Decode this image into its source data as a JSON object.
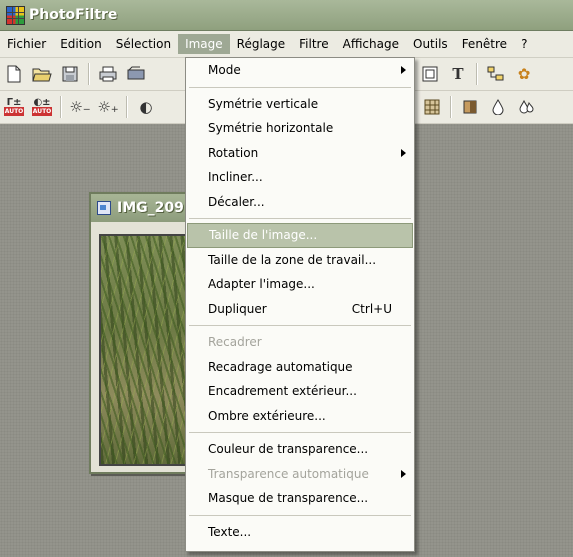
{
  "app": {
    "title": "PhotoFiltre"
  },
  "menubar": {
    "items": [
      {
        "label": "Fichier"
      },
      {
        "label": "Edition"
      },
      {
        "label": "Sélection"
      },
      {
        "label": "Image"
      },
      {
        "label": "Réglage"
      },
      {
        "label": "Filtre"
      },
      {
        "label": "Affichage"
      },
      {
        "label": "Outils"
      },
      {
        "label": "Fenêtre"
      },
      {
        "label": "?"
      }
    ]
  },
  "toolbar2": {
    "auto_label": "AUTO"
  },
  "document": {
    "title": "IMG_209"
  },
  "image_menu": {
    "groups": [
      [
        {
          "label": "Mode",
          "submenu": true
        }
      ],
      [
        {
          "label": "Symétrie verticale"
        },
        {
          "label": "Symétrie horizontale"
        },
        {
          "label": "Rotation",
          "submenu": true
        },
        {
          "label": "Incliner..."
        },
        {
          "label": "Décaler..."
        }
      ],
      [
        {
          "label": "Taille de l'image...",
          "highlighted": true
        },
        {
          "label": "Taille de la zone de travail..."
        },
        {
          "label": "Adapter l'image..."
        },
        {
          "label": "Dupliquer",
          "shortcut": "Ctrl+U"
        }
      ],
      [
        {
          "label": "Recadrer",
          "disabled": true
        },
        {
          "label": "Recadrage automatique"
        },
        {
          "label": "Encadrement extérieur..."
        },
        {
          "label": "Ombre extérieure..."
        }
      ],
      [
        {
          "label": "Couleur de transparence..."
        },
        {
          "label": "Transparence automatique",
          "disabled": true,
          "submenu": true
        },
        {
          "label": "Masque de transparence..."
        }
      ],
      [
        {
          "label": "Texte..."
        }
      ]
    ]
  }
}
